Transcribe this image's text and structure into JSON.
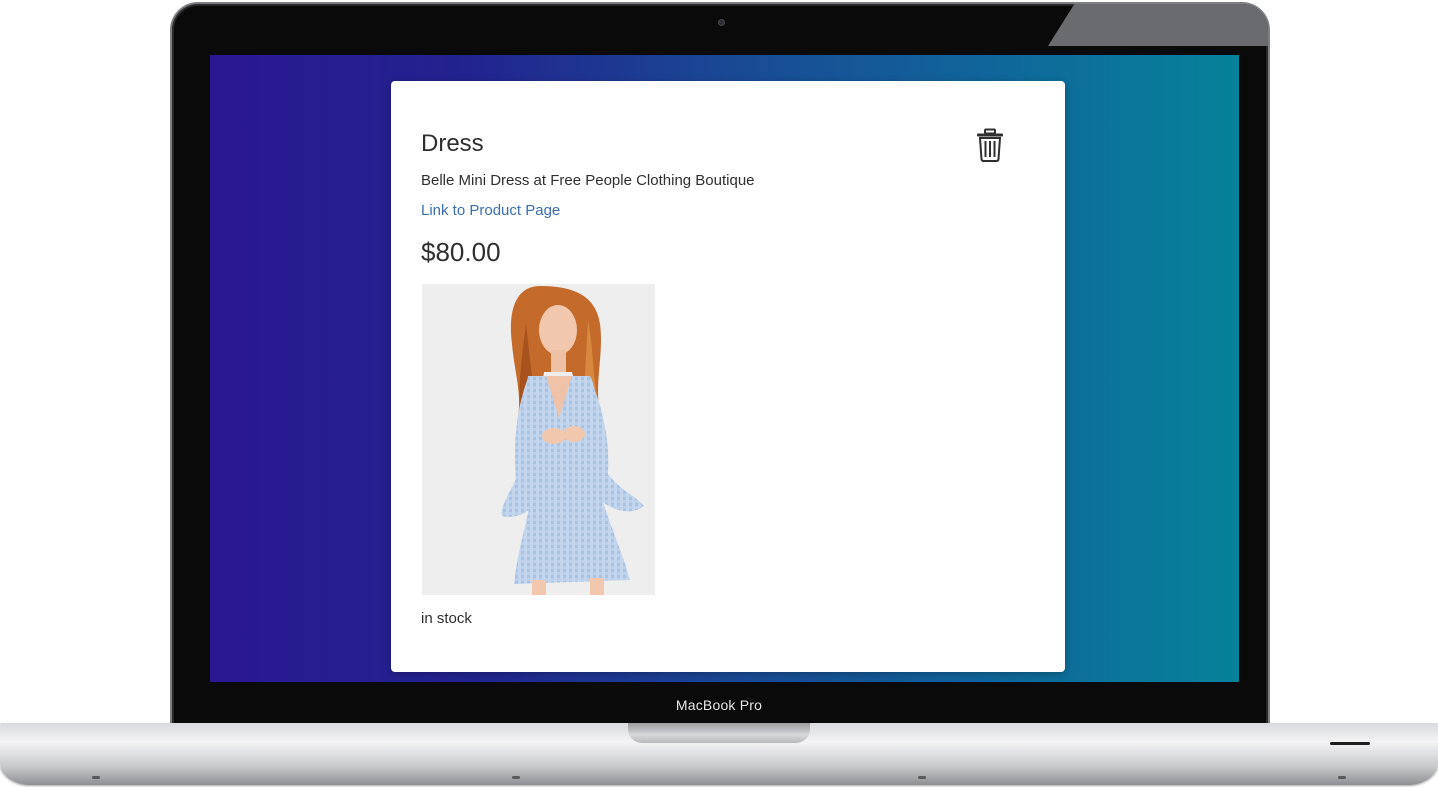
{
  "device": {
    "label": "MacBook Pro"
  },
  "product": {
    "title": "Dress",
    "description": "Belle Mini Dress at Free People Clothing Boutique",
    "link_label": "Link to Product Page",
    "price": "$80.00",
    "stock_status": "in stock",
    "image_alt": "Model wearing light blue gingham bell-sleeve mini dress"
  },
  "icons": {
    "delete": "trash-icon"
  },
  "colors": {
    "screen_gradient_start": "#2a1791",
    "screen_gradient_end": "#06829a",
    "link": "#3a6fb0",
    "card_background": "#ffffff"
  }
}
